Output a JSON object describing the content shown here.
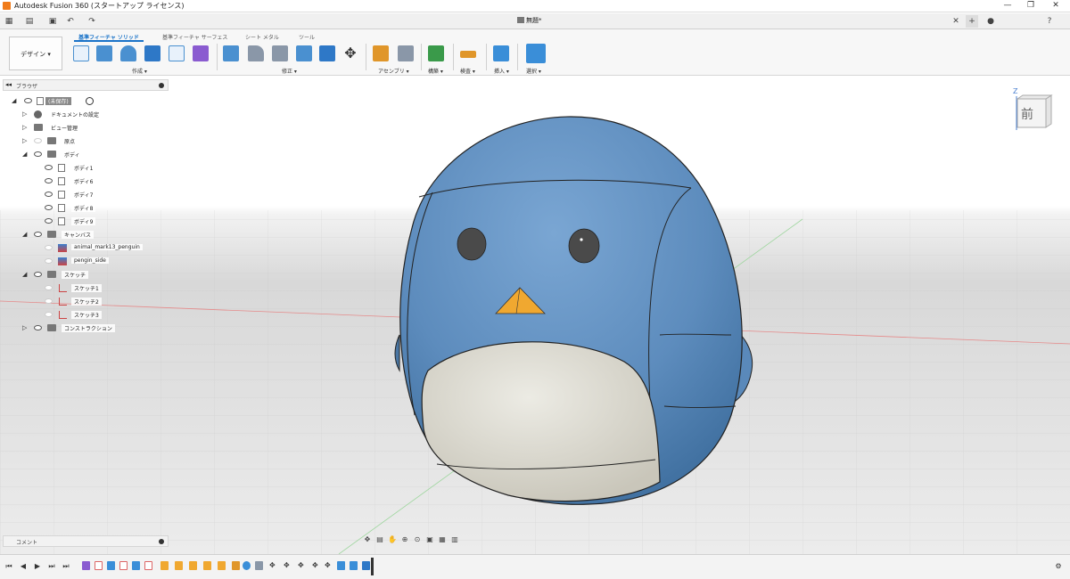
{
  "window": {
    "title": "Autodesk Fusion 360 (スタートアップ ライセンス)",
    "document_tab": "無題*"
  },
  "workspace": {
    "label": "デザイン ▾"
  },
  "ribbon": {
    "tabs": [
      {
        "label": "基準フィーチャ ソリッド"
      },
      {
        "label": "基準フィーチャ サーフェス"
      },
      {
        "label": "シート メタル"
      },
      {
        "label": "ツール"
      }
    ],
    "groups": [
      {
        "label": "作成 ▾"
      },
      {
        "label": "修正 ▾"
      },
      {
        "label": "アセンブリ ▾"
      },
      {
        "label": "構築 ▾"
      },
      {
        "label": "検査 ▾"
      },
      {
        "label": "挿入 ▾"
      },
      {
        "label": "選択 ▾"
      }
    ]
  },
  "browser": {
    "header": "ブラウザ",
    "root": "(未保存)",
    "items": [
      {
        "label": "ドキュメントの設定"
      },
      {
        "label": "ビュー管理"
      },
      {
        "label": "原点"
      },
      {
        "label": "ボディ"
      },
      {
        "label": "ボディ1"
      },
      {
        "label": "ボディ6"
      },
      {
        "label": "ボディ7"
      },
      {
        "label": "ボディ8"
      },
      {
        "label": "ボディ9"
      },
      {
        "label": "キャンバス"
      },
      {
        "label": "animal_mark13_penguin"
      },
      {
        "label": "pengin_side"
      },
      {
        "label": "スケッチ"
      },
      {
        "label": "スケッチ1"
      },
      {
        "label": "スケッチ2"
      },
      {
        "label": "スケッチ3"
      },
      {
        "label": "コンストラクション"
      }
    ]
  },
  "comments": {
    "label": "コメント"
  },
  "viewcube": {
    "face": "前",
    "axis": "Z"
  },
  "colors": {
    "penguin_blue": "#5f8fc0",
    "belly": "#ddd9cc",
    "beak": "#f0a830",
    "accent": "#1a73c8"
  }
}
